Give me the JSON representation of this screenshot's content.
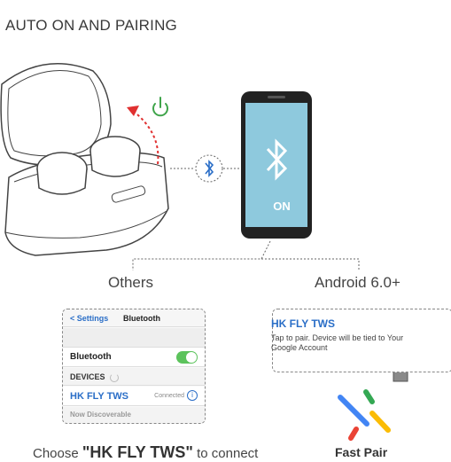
{
  "title": "AUTO ON AND PAIRING",
  "phone": {
    "on_label": "ON"
  },
  "section_left": "Others",
  "section_right": "Android 6.0+",
  "ios": {
    "back_label": "< Settings",
    "nav_title": "Bluetooth",
    "bluetooth_label": "Bluetooth",
    "devices_label": "DEVICES",
    "device_name": "HK FLY TWS",
    "device_status": "Connected",
    "discoverable_label": "Now Discoverable"
  },
  "android": {
    "device_name": "HK FLY TWS",
    "description": "Tap to pair. Device will be tied to Your Google Account"
  },
  "caption_left": {
    "prefix": "Choose ",
    "device": "\"HK FLY TWS\"",
    "suffix": " to connect"
  },
  "caption_right": "Fast Pair",
  "colors": {
    "screen": "#8ec9dd",
    "accent_blue": "#2a6ec7",
    "power_green": "#3fa44a",
    "arrow_red": "#e03030",
    "toggle_green": "#5cc35c",
    "tap_red": "#e05a3a"
  },
  "icons": [
    "power-icon",
    "bluetooth-icon",
    "hand-tap-icon",
    "earbuds-icon",
    "fast-pair-logo"
  ]
}
